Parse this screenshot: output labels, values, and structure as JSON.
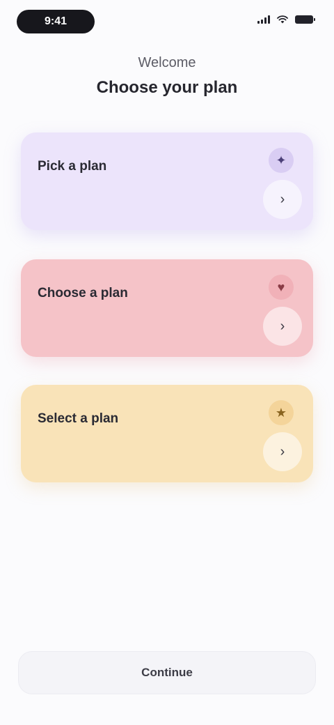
{
  "status_bar": {
    "time": "9:41"
  },
  "header": {
    "eyebrow": "Welcome",
    "title": "Choose your plan"
  },
  "cards": [
    {
      "title": "Pick a plan",
      "subtitle": "",
      "meta": "",
      "top_icon": "sparkle-icon",
      "action_icon": "chevron-right-icon"
    },
    {
      "title": "Choose a plan",
      "subtitle": "",
      "meta": "",
      "top_icon": "heart-icon",
      "action_icon": "chevron-right-icon"
    },
    {
      "title": "Select a plan",
      "subtitle": "",
      "meta": "",
      "top_icon": "star-icon",
      "action_icon": "chevron-right-icon"
    }
  ],
  "bottom_button": {
    "label": "Continue"
  },
  "colors": {
    "card_purple": "#ece4fb",
    "card_pink": "#f5c3c8",
    "card_yellow": "#f9e3b8"
  }
}
